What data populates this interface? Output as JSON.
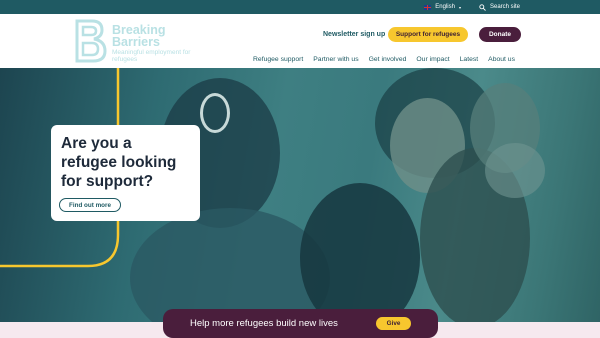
{
  "utility_bar": {
    "language": "English",
    "search_label": "Search site"
  },
  "header": {
    "logo": {
      "line1": "Breaking",
      "line2": "Barriers",
      "tagline": "Meaningful employment for refugees"
    },
    "newsletter_label": "Newsletter sign up",
    "support_button": "Support for refugees",
    "donate_button": "Donate"
  },
  "nav": {
    "items": [
      {
        "label": "Refugee support"
      },
      {
        "label": "Partner with us"
      },
      {
        "label": "Get involved"
      },
      {
        "label": "Our impact"
      },
      {
        "label": "Latest"
      },
      {
        "label": "About us"
      }
    ]
  },
  "hero": {
    "title": "Are you a refugee looking for support?",
    "cta": "Find out more"
  },
  "donate_bar": {
    "text": "Help more refugees build new lives",
    "button": "Give"
  },
  "colors": {
    "brand_teal": "#1f5a63",
    "accent_yellow": "#f7c72e",
    "plum": "#4a1e3c"
  }
}
